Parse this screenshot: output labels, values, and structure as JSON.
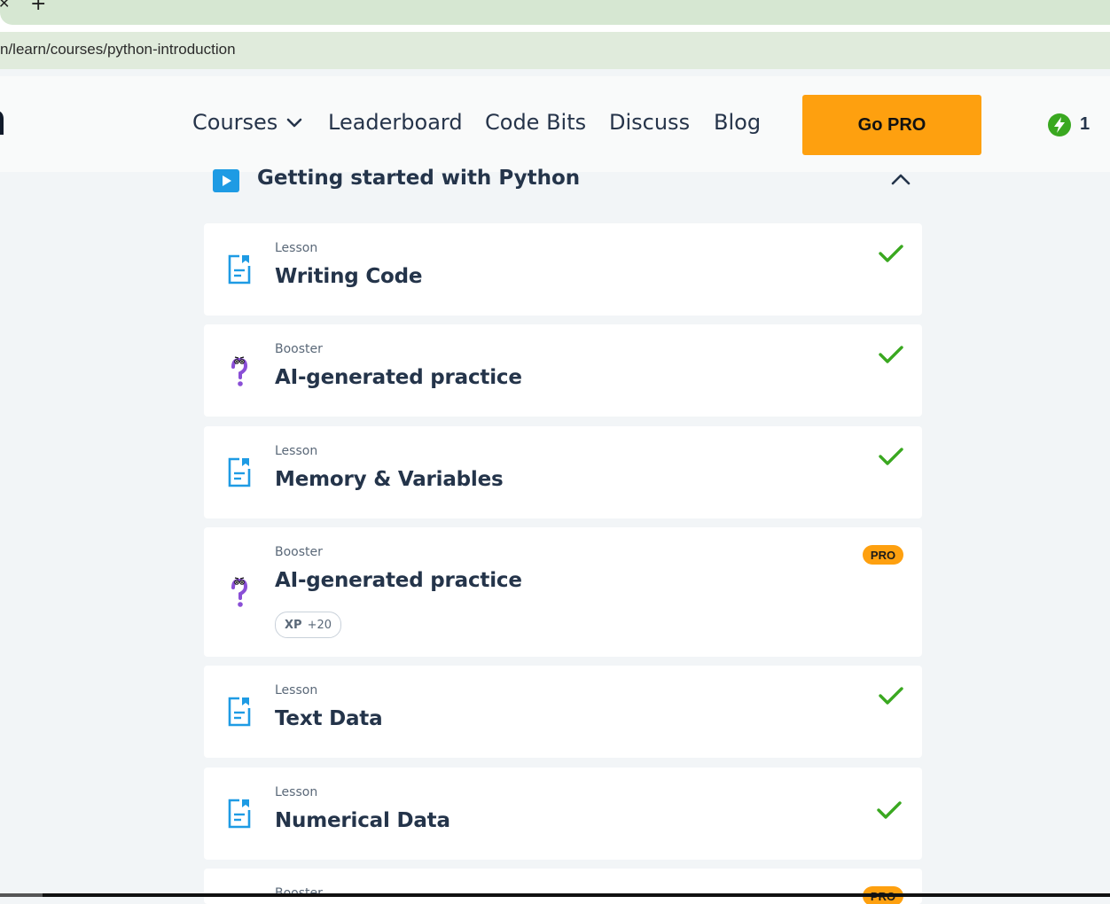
{
  "browser": {
    "new_tab_symbol": "+",
    "url": "n/learn/courses/python-introduction"
  },
  "header": {
    "nav": {
      "courses": "Courses",
      "leaderboard": "Leaderboard",
      "code_bits": "Code Bits",
      "discuss": "Discuss",
      "blog": "Blog"
    },
    "go_pro": "Go PRO",
    "streak_count": "1"
  },
  "module": {
    "title": "Getting started with Python",
    "expanded": true
  },
  "items": [
    {
      "type": "Lesson",
      "title": "Writing Code",
      "status": "completed",
      "icon": "lesson-doc-icon"
    },
    {
      "type": "Booster",
      "title": "AI-generated practice",
      "status": "completed",
      "icon": "question-mascot-icon"
    },
    {
      "type": "Lesson",
      "title": "Memory & Variables",
      "status": "completed",
      "icon": "lesson-doc-icon"
    },
    {
      "type": "Booster",
      "title": "AI-generated practice",
      "status": "pro",
      "badge": "PRO",
      "xp_label": "XP",
      "xp_value": "+20",
      "icon": "question-mascot-icon"
    },
    {
      "type": "Lesson",
      "title": "Text Data",
      "status": "completed",
      "icon": "lesson-doc-icon"
    },
    {
      "type": "Lesson",
      "title": "Numerical Data",
      "status": "completed",
      "icon": "lesson-doc-icon"
    },
    {
      "type": "Booster",
      "title": "",
      "status": "pro",
      "badge": "PRO",
      "icon": "question-mascot-icon"
    }
  ],
  "colors": {
    "accent_blue": "#1e9be4",
    "check_green": "#3aa820",
    "pro_orange": "#fea00f",
    "text_dark": "#24344a",
    "mascot_purple": "#8a4fd6"
  }
}
